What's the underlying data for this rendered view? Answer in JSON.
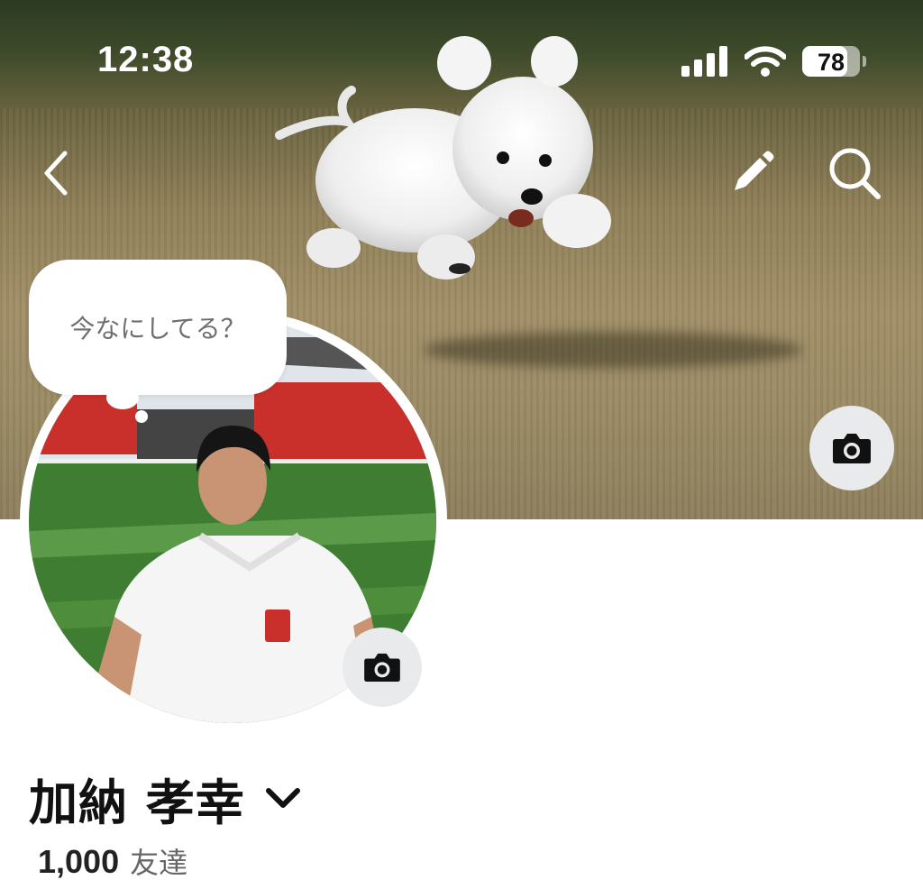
{
  "status_bar": {
    "time": "12:38",
    "battery_level": "78",
    "battery_fraction": 0.78,
    "icons": [
      "signal-icon",
      "wifi-icon",
      "battery-icon"
    ]
  },
  "header": {
    "back_icon": "chevron-left-icon",
    "edit_icon": "pencil-icon",
    "search_icon": "search-icon"
  },
  "cover": {
    "image": "white-dog-running-on-grass",
    "camera_icon": "camera-icon"
  },
  "avatar": {
    "image": "man-in-white-polo-at-stadium",
    "camera_icon": "camera-icon"
  },
  "status_bubble": {
    "placeholder": "今なにしてる？"
  },
  "profile": {
    "name": "加納 孝幸",
    "name_toggle_icon": "chevron-down-icon",
    "friends_count": "1,000",
    "friends_label": "友達"
  }
}
